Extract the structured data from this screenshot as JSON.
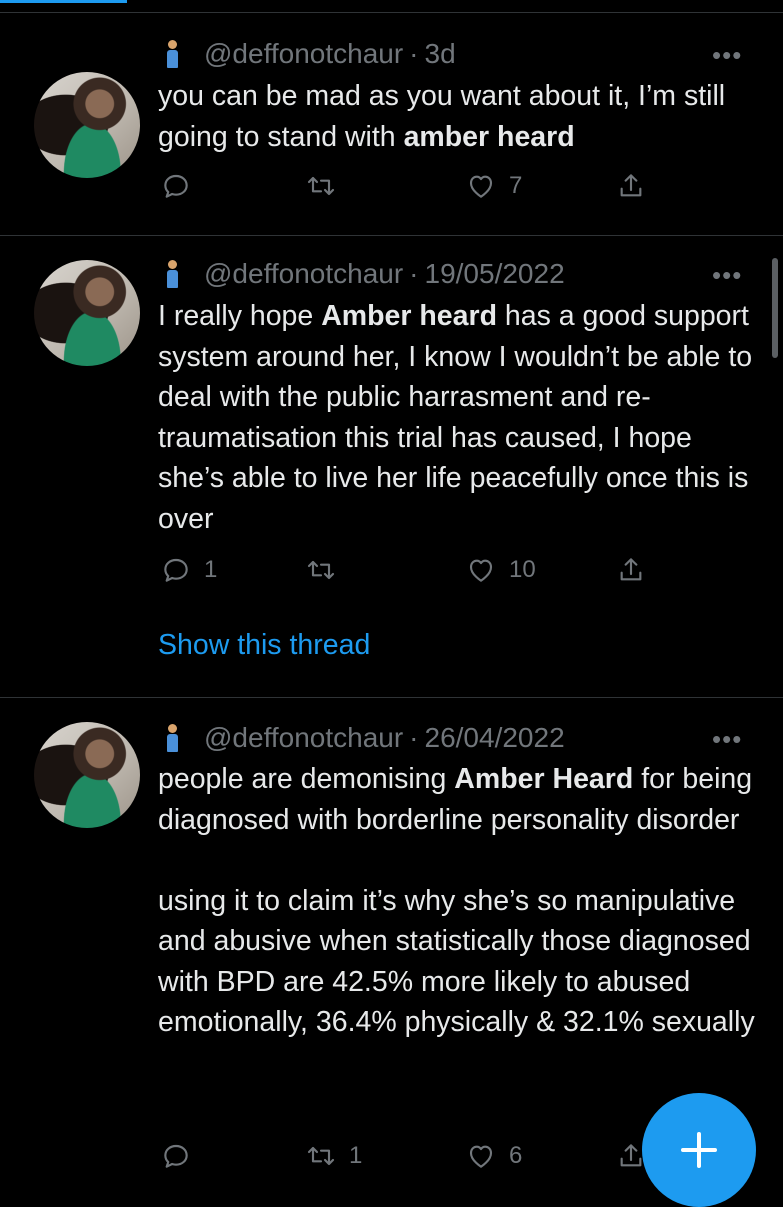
{
  "tweets": [
    {
      "handle": "@deffonotchaur",
      "separator": "·",
      "time": "3d",
      "more": "•••",
      "text_parts": [
        "you can be mad as you want about it, I’m still going to stand with ",
        "amber heard",
        ""
      ],
      "replies": "",
      "retweets": "",
      "likes": "7"
    },
    {
      "handle": "@deffonotchaur",
      "separator": "·",
      "time": "19/05/2022",
      "more": "•••",
      "text_parts": [
        "I really hope ",
        "Amber heard",
        " has a good support system around her, I know I wouldn’t be able to deal with the public harrasment and re-traumatisation this trial has caused, I hope she’s able to live her life peacefully once this is over"
      ],
      "replies": "1",
      "retweets": "",
      "likes": "10",
      "show_thread": "Show this thread"
    },
    {
      "handle": "@deffonotchaur",
      "separator": "·",
      "time": "26/04/2022",
      "more": "•••",
      "text_parts": [
        "people are demonising ",
        "Amber Heard",
        " for being diagnosed with borderline personality disorder\n\nusing it to claim it’s why she’s so manipulative and abusive when statistically those diagnosed with BPD are 42.5% more likely to abused emotionally, 36.4% physically & 32.1% sexually"
      ],
      "replies": "",
      "retweets": "1",
      "likes": "6"
    }
  ],
  "icons": {
    "reply": "reply-icon",
    "retweet": "retweet-icon",
    "like": "heart-icon",
    "share": "share-icon",
    "compose": "plus-icon"
  },
  "colors": {
    "background": "#000000",
    "text": "#e7e9ea",
    "muted": "#71767b",
    "accent": "#1d9bf0"
  }
}
